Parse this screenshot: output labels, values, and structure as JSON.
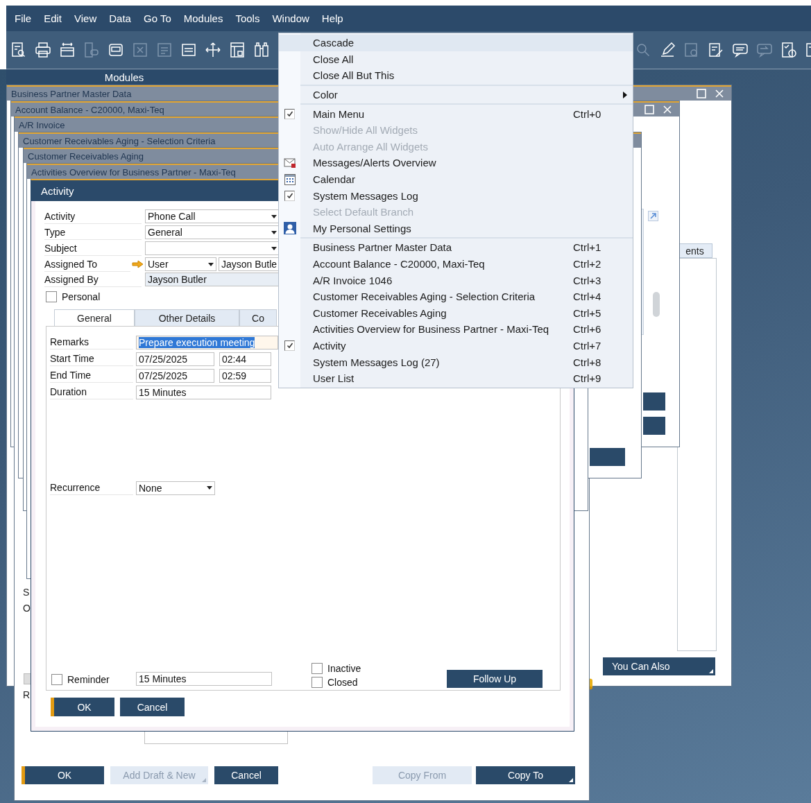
{
  "menu_bar": {
    "items": [
      {
        "label": "File"
      },
      {
        "label": "Edit"
      },
      {
        "label": "View"
      },
      {
        "label": "Data"
      },
      {
        "label": "Go To"
      },
      {
        "label": "Modules"
      },
      {
        "label": "Tools"
      },
      {
        "label": "Window"
      },
      {
        "label": "Help"
      }
    ]
  },
  "toolbar": {
    "left": [
      {
        "disabled": false
      },
      {
        "disabled": false
      },
      {
        "disabled": false
      },
      {
        "disabled": true
      },
      {
        "disabled": false
      },
      {
        "disabled": true
      },
      {
        "disabled": true
      },
      {
        "disabled": false
      },
      {
        "disabled": false
      },
      {
        "disabled": false
      },
      {
        "disabled": false
      }
    ],
    "right": [
      {
        "disabled": true
      },
      {
        "disabled": false
      },
      {
        "disabled": true
      },
      {
        "disabled": false
      },
      {
        "disabled": false
      },
      {
        "disabled": true
      },
      {
        "disabled": false
      },
      {
        "disabled": false
      }
    ]
  },
  "side_panel": {
    "title": "Modules"
  },
  "windows": [
    {
      "kind": "partner",
      "title": "Business Partner Master Data",
      "tab": "ents",
      "button": "You Can Also"
    },
    {
      "kind": "balance",
      "title": "Account Balance - C20000, Maxi-Teq"
    },
    {
      "kind": "invoice",
      "title": "A/R Invoice",
      "labels": [
        "S",
        "O",
        "R"
      ],
      "check": {
        "checked": false,
        "disabled": true
      },
      "buttons": [
        {
          "label": "OK",
          "default": true,
          "disabled": false,
          "dropdown": false
        },
        {
          "label": "Add Draft & New",
          "default": false,
          "disabled": true,
          "dropdown": true
        },
        {
          "label": "Cancel",
          "default": false,
          "disabled": false,
          "dropdown": false
        },
        {
          "label": "Copy From",
          "default": false,
          "disabled": true,
          "dropdown": false
        },
        {
          "label": "Copy To",
          "default": false,
          "disabled": false,
          "dropdown": true
        }
      ]
    },
    {
      "kind": "criteria",
      "title": "Customer Receivables Aging - Selection Criteria"
    },
    {
      "kind": "aging",
      "title": "Customer Receivables Aging"
    },
    {
      "kind": "overview",
      "title": "Activities Overview for Business Partner - Maxi-Teq"
    }
  ],
  "activity_window": {
    "title": "Activity",
    "fields": [
      {
        "kind": "dropdown",
        "label": "Activity",
        "value": "Phone Call"
      },
      {
        "kind": "dropdown",
        "label": "Type",
        "value": "General"
      },
      {
        "kind": "dropdown",
        "label": "Subject"
      },
      {
        "kind": "assign",
        "label": "Assigned To",
        "value": "User",
        "value_2": "Jayson Butle"
      },
      {
        "kind": "readonly",
        "label": "Assigned By",
        "value": "Jayson Butler"
      }
    ],
    "personal": {
      "label": "Personal",
      "checked": false
    },
    "tabs": [
      {
        "label": "General",
        "selected": true
      },
      {
        "label": "Other Details",
        "selected": false
      },
      {
        "label": "Co",
        "selected": false
      }
    ],
    "remarks": {
      "label": "Remarks",
      "value": "Prepare execution meeting"
    },
    "times": [
      {
        "label": "Start Time",
        "date": "07/25/2025",
        "time": "02:44"
      },
      {
        "label": "End Time",
        "date": "07/25/2025",
        "time": "02:59"
      }
    ],
    "duration": {
      "label": "Duration",
      "value": "15 Minutes"
    },
    "recurrence": {
      "label": "Recurrence",
      "value": "None"
    },
    "reminder": {
      "label": "Reminder",
      "checked": false,
      "value": "15 Minutes"
    },
    "flags": [
      {
        "label": "Inactive",
        "checked": false
      },
      {
        "label": "Closed",
        "checked": false
      }
    ],
    "follow_up": "Follow Up",
    "buttons": [
      {
        "label": "OK",
        "default": true
      },
      {
        "label": "Cancel",
        "default": false
      }
    ]
  },
  "window_menu": {
    "groups": [
      [
        {
          "kind": "plain",
          "label": "Cascade",
          "selected": true,
          "disabled": false
        },
        {
          "kind": "plain",
          "label": "Close All",
          "selected": false,
          "disabled": false
        },
        {
          "kind": "plain",
          "label": "Close All But This",
          "selected": false,
          "disabled": false
        }
      ],
      [
        {
          "kind": "submenu",
          "label": "Color",
          "selected": false,
          "disabled": false
        }
      ],
      [
        {
          "kind": "toggle",
          "label": "Main Menu",
          "shortcut": "Ctrl+0",
          "checked": true,
          "selected": false,
          "disabled": false
        },
        {
          "kind": "plain",
          "label": "Show/Hide All Widgets",
          "selected": false,
          "disabled": true
        },
        {
          "kind": "plain",
          "label": "Auto Arrange All Widgets",
          "selected": false,
          "disabled": true
        },
        {
          "kind": "messages",
          "label": "Messages/Alerts Overview",
          "selected": false,
          "disabled": false
        },
        {
          "kind": "calendar",
          "label": "Calendar",
          "selected": false,
          "disabled": false
        },
        {
          "kind": "toggle",
          "label": "System Messages Log",
          "checked": true,
          "selected": false,
          "disabled": false
        },
        {
          "kind": "plain",
          "label": "Select Default Branch",
          "selected": false,
          "disabled": true
        },
        {
          "kind": "profile",
          "label": "My Personal Settings",
          "selected": false,
          "disabled": false
        }
      ],
      [
        {
          "kind": "plain",
          "label": "Business Partner Master Data",
          "shortcut": "Ctrl+1",
          "selected": false,
          "disabled": false
        },
        {
          "kind": "plain",
          "label": "Account Balance - C20000, Maxi-Teq",
          "shortcut": "Ctrl+2",
          "selected": false,
          "disabled": false
        },
        {
          "kind": "plain",
          "label": "A/R Invoice 1046",
          "shortcut": "Ctrl+3",
          "selected": false,
          "disabled": false
        },
        {
          "kind": "plain",
          "label": "Customer Receivables Aging - Selection Criteria",
          "shortcut": "Ctrl+4",
          "selected": false,
          "disabled": false
        },
        {
          "kind": "plain",
          "label": "Customer Receivables Aging",
          "shortcut": "Ctrl+5",
          "selected": false,
          "disabled": false
        },
        {
          "kind": "plain",
          "label": "Activities Overview for Business Partner - Maxi-Teq",
          "shortcut": "Ctrl+6",
          "selected": false,
          "disabled": false
        },
        {
          "kind": "toggle",
          "label": "Activity",
          "shortcut": "Ctrl+7",
          "checked": true,
          "selected": false,
          "disabled": false
        },
        {
          "kind": "plain",
          "label": "System Messages Log (27)",
          "shortcut": "Ctrl+8",
          "selected": false,
          "disabled": false
        },
        {
          "kind": "plain",
          "label": "User List",
          "shortcut": "Ctrl+9",
          "selected": false,
          "disabled": false
        }
      ]
    ]
  }
}
